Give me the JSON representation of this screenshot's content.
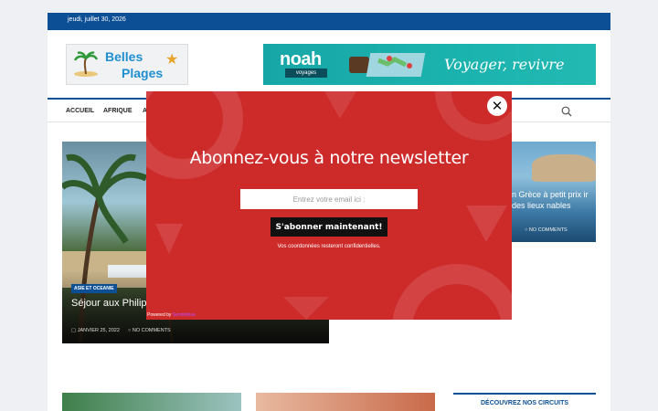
{
  "topbar": {
    "date": "jeudi, juillet 30, 2026"
  },
  "logo": {
    "line1": "Belles",
    "line2": "Plages"
  },
  "banner": {
    "brand": "noah",
    "sub": "voyages",
    "slogan": "Voyager, revivre"
  },
  "nav": {
    "items": [
      "ACCUEIL",
      "AFRIQUE",
      "A"
    ]
  },
  "featured": {
    "category": "ASIE ET OCEANIE",
    "title": "Séjour aux Philip... retenir",
    "date": "JANVIER 25, 2022",
    "comments": "NO COMMENTS"
  },
  "side_card": {
    "title": "n Grèce à petit prix ir des lieux nables",
    "comments": "NO COMMENTS"
  },
  "sidebar": {
    "heading": "DÉCOUVREZ NOS CIRCUITS"
  },
  "modal": {
    "heading": "Abonnez-vous à notre newsletter",
    "email_placeholder": "Entrez votre email ici :",
    "subscribe_label": "S'abonner maintenant!",
    "note": "Vos coordonnées resteront confidentielles.",
    "powered_prefix": "Powered by",
    "powered_brand": "Sendinblue",
    "close_glyph": "✕"
  },
  "colors": {
    "brand_blue": "#0d4f95",
    "modal_red": "#cd2a2a"
  }
}
